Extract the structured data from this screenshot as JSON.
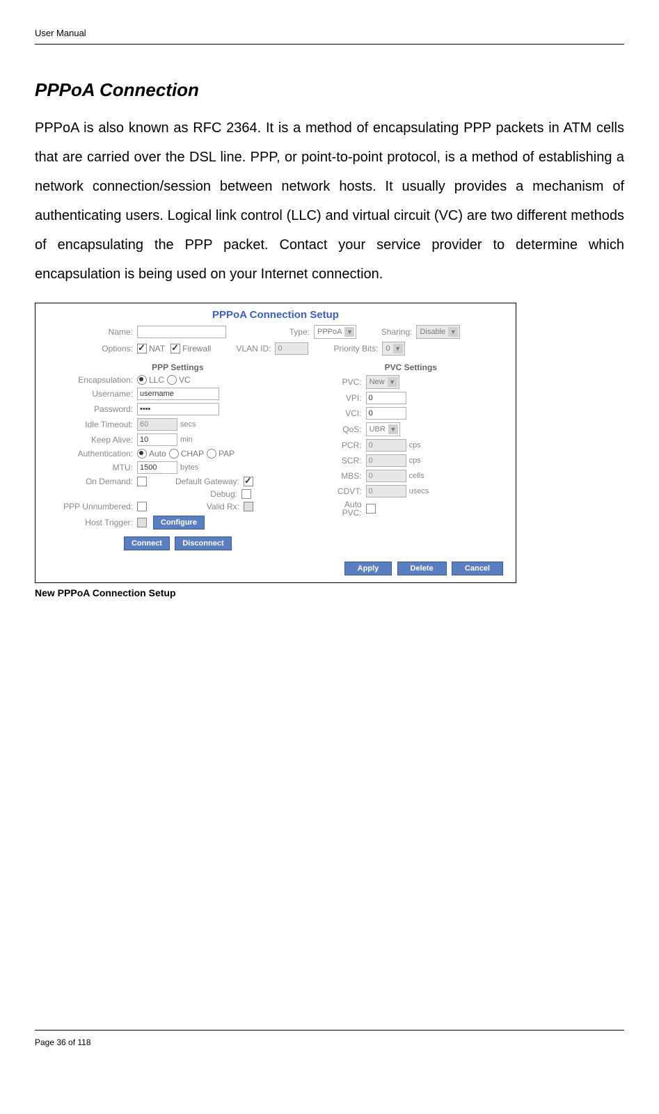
{
  "doc": {
    "header": "User Manual",
    "section_title": "PPPoA Connection",
    "body_text": "PPPoA is also known as RFC 2364. It is a method of encapsulating PPP packets in ATM cells that are carried over the DSL line. PPP, or point-to-point protocol, is a method of establishing a network connection/session between network hosts. It usually provides a mechanism of authenticating users. Logical link control (LLC) and virtual circuit (VC) are two different methods of encapsulating the PPP packet. Contact your service provider to determine which encapsulation is being used on your Internet connection.",
    "caption": "New PPPoA Connection Setup",
    "footer": "Page 36 of 118"
  },
  "form": {
    "title": "PPPoA Connection Setup",
    "top": {
      "name_lbl": "Name:",
      "name_val": "",
      "type_lbl": "Type:",
      "type_val": "PPPoA",
      "sharing_lbl": "Sharing:",
      "sharing_val": "Disable",
      "options_lbl": "Options:",
      "opt_nat": "NAT",
      "opt_fw": "Firewall",
      "vlan_lbl": "VLAN ID:",
      "vlan_val": "0",
      "prio_lbl": "Priority Bits:",
      "prio_val": "0"
    },
    "ppp": {
      "heading": "PPP Settings",
      "encap_lbl": "Encapsulation:",
      "encap_llc": "LLC",
      "encap_vc": "VC",
      "user_lbl": "Username:",
      "user_val": "username",
      "pass_lbl": "Password:",
      "pass_val": "••••",
      "idle_lbl": "Idle Timeout:",
      "idle_val": "60",
      "idle_unit": "secs",
      "keep_lbl": "Keep Alive:",
      "keep_val": "10",
      "keep_unit": "min",
      "auth_lbl": "Authentication:",
      "auth_auto": "Auto",
      "auth_chap": "CHAP",
      "auth_pap": "PAP",
      "mtu_lbl": "MTU:",
      "mtu_val": "1500",
      "mtu_unit": "bytes",
      "ondemand_lbl": "On Demand:",
      "defgw_lbl": "Default Gateway:",
      "debug_lbl": "Debug:",
      "unnum_lbl": "PPP Unnumbered:",
      "validrx_lbl": "Valid Rx:",
      "host_lbl": "Host Trigger:",
      "config_btn": "Configure"
    },
    "pvc": {
      "heading": "PVC Settings",
      "pvc_lbl": "PVC:",
      "pvc_val": "New",
      "vpi_lbl": "VPI:",
      "vpi_val": "0",
      "vci_lbl": "VCI:",
      "vci_val": "0",
      "qos_lbl": "QoS:",
      "qos_val": "UBR",
      "pcr_lbl": "PCR:",
      "pcr_val": "0",
      "pcr_unit": "cps",
      "scr_lbl": "SCR:",
      "scr_val": "0",
      "scr_unit": "cps",
      "mbs_lbl": "MBS:",
      "mbs_val": "0",
      "mbs_unit": "cells",
      "cdvt_lbl": "CDVT:",
      "cdvt_val": "0",
      "cdvt_unit": "usecs",
      "autopvc_lbl": "Auto\nPVC:"
    },
    "buttons": {
      "connect": "Connect",
      "disconnect": "Disconnect",
      "apply": "Apply",
      "delete": "Delete",
      "cancel": "Cancel"
    }
  }
}
